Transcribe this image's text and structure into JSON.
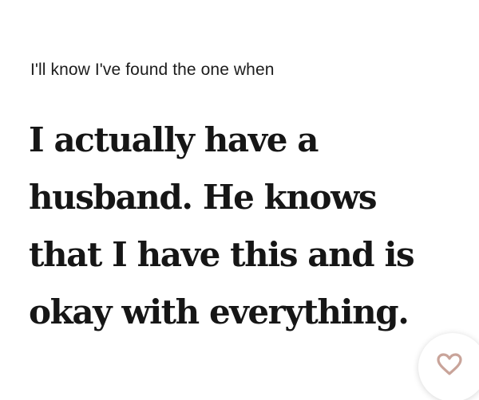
{
  "prompt": {
    "label": "I'll know I've found the one when"
  },
  "answer": {
    "lines": [
      "I actually have a",
      "husband. He knows",
      "that I have this and is",
      "okay with everything."
    ]
  },
  "like_button": {
    "icon": "heart-icon",
    "color": "#c9a49a"
  }
}
